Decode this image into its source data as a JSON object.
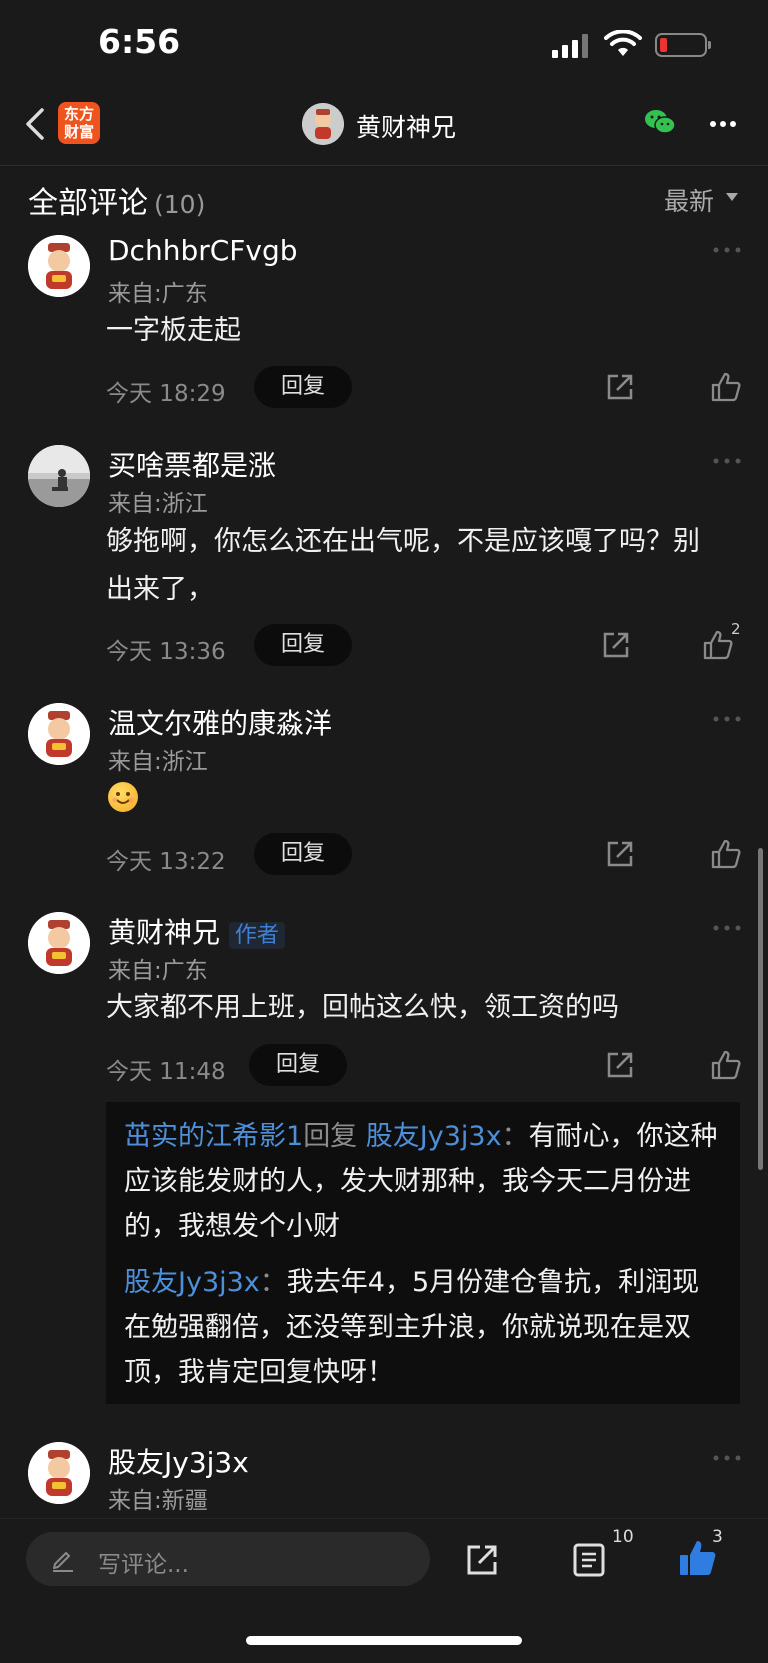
{
  "status_bar": {
    "time": "6:56"
  },
  "nav": {
    "logo_line1": "东方",
    "logo_line2": "财富",
    "title": "黄财神兄"
  },
  "header": {
    "title": "全部评论",
    "count": "(10)",
    "sort": "最新"
  },
  "comments": [
    {
      "name": "DchhbrCFvgb",
      "loc": "来自:广东",
      "text": "一字板走起",
      "time": "今天 18:29",
      "reply": "回复"
    },
    {
      "name": "买啥票都是涨",
      "loc": "来自:浙江",
      "text": "够拖啊，你怎么还在出气呢，不是应该嘎了吗？别出来了，",
      "time": "今天 13:36",
      "reply": "回复",
      "likes": "2"
    },
    {
      "name": "温文尔雅的康淼洋",
      "loc": "来自:浙江",
      "time": "今天 13:22",
      "reply": "回复"
    },
    {
      "name": "黄财神兄",
      "tag": "作者",
      "loc": "来自:广东",
      "text": "大家都不用上班，回帖这么快，领工资的吗",
      "time": "今天 11:48",
      "reply": "回复",
      "sub": [
        {
          "user": "茁实的江希影1",
          "verb": "回复",
          "target": "股友Jy3j3x",
          "sep": "：",
          "text": "有耐心，你这种应该能发财的人，发大财那种，我今天二月份进的，我想发个小财"
        },
        {
          "user": "股友Jy3j3x",
          "sep": "：",
          "text": "我去年4，5月份建仓鲁抗，利润现在勉强翻倍，还没等到主升浪，你就说现在是双顶，我肯定回复快呀！"
        }
      ]
    },
    {
      "name": "股友Jy3j3x",
      "loc": "来自:新疆"
    }
  ],
  "bottom": {
    "placeholder": "写评论...",
    "list_count": "10",
    "like_count": "3"
  },
  "colors": {
    "accent_blue": "#3f80d6",
    "brand_orange": "#f0541e"
  }
}
